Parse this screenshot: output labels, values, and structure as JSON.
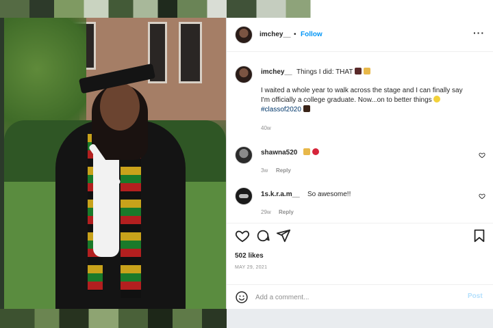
{
  "post": {
    "username": "imchey__",
    "separator": "•",
    "follow_label": "Follow",
    "more_label": "···",
    "caption": {
      "title": "Things I did: THAT",
      "body_line1": "I waited a whole year to walk across the stage and I can finally say",
      "body_line2": "I'm officially a college graduate. Now...on to better things",
      "hashtag": "#classof2020",
      "age": "40w"
    },
    "comments": [
      {
        "username": "shawna520",
        "text": "",
        "age": "3w",
        "reply_label": "Reply"
      },
      {
        "username": "1s.k.r.a.m__",
        "text": "So awesome!!",
        "age": "29w",
        "reply_label": "Reply"
      }
    ],
    "likes": "502 likes",
    "date": "MAY 29, 2021",
    "comment_placeholder": "Add a comment...",
    "post_label": "Post"
  },
  "icons": {
    "like": "heart-icon",
    "comment": "comment-icon",
    "share": "share-icon",
    "save": "bookmark-icon",
    "emoji": "smiley-icon",
    "more": "more-icon"
  },
  "colors": {
    "link_blue": "#0095f6",
    "heart_red": "#ed4956"
  }
}
